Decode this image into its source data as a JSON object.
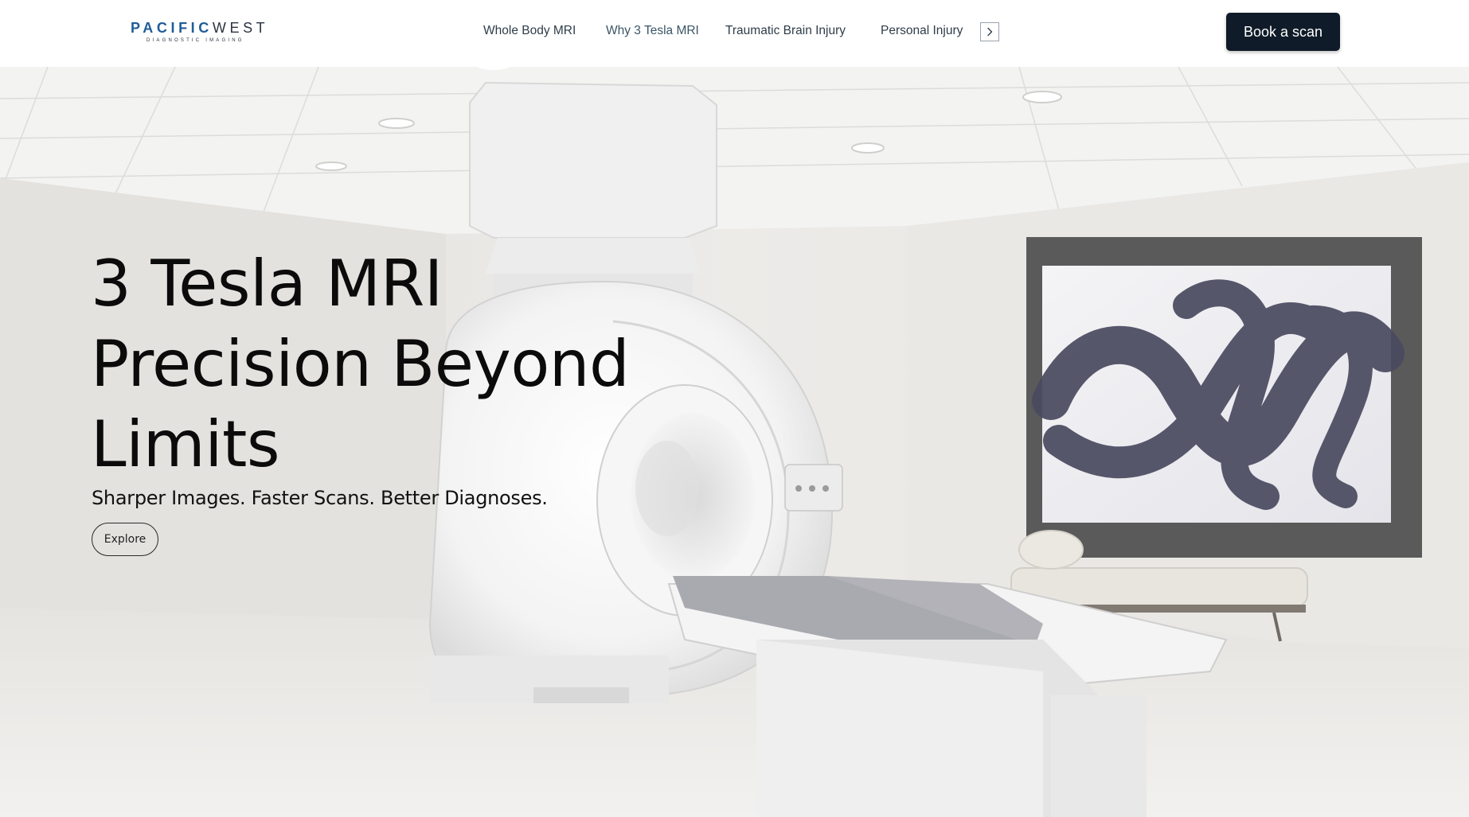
{
  "brand": {
    "name_part1": "PACIFIC",
    "name_part2": "WEST",
    "tagline": "DIAGNOSTIC IMAGING",
    "primary_color": "#1f5d99",
    "dark_color": "#0f1b28"
  },
  "nav": {
    "items": [
      {
        "label": "Whole Body MRI"
      },
      {
        "label": "Why 3 Tesla MRI"
      },
      {
        "label": "Traumatic Brain Injury"
      },
      {
        "label": "Personal Injury"
      }
    ],
    "more_icon": "chevron-right-icon"
  },
  "cta": {
    "book_label": "Book a scan"
  },
  "hero": {
    "title_lines": [
      "3 Tesla MRI",
      "Precision Beyond",
      "Limits"
    ],
    "subtitle": "Sharper Images. Faster Scans. Better Diagnoses.",
    "explore_label": "Explore",
    "image_subject": "MRI scanner room with artwork"
  }
}
